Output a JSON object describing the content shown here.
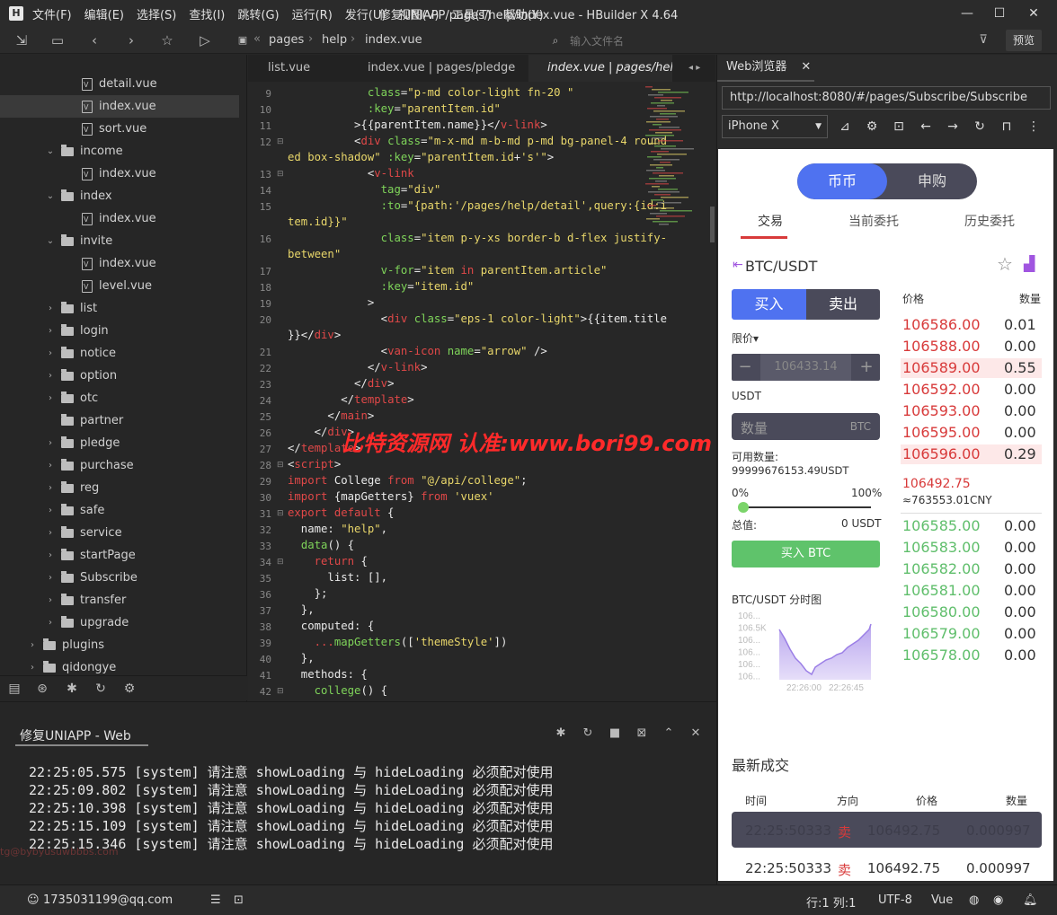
{
  "titlebar": {
    "app_icon": "H",
    "menu": [
      "文件(F)",
      "编辑(E)",
      "选择(S)",
      "查找(I)",
      "跳转(G)",
      "运行(R)",
      "发行(U)",
      "视图(V)",
      "工具(T)",
      "帮助(Y)"
    ],
    "title": "修复UNIAPP/pages/help/index.vue - HBuilder X 4.64"
  },
  "toolbar": {
    "breadcrumb": [
      "pages",
      "help",
      "index.vue"
    ],
    "file_search_placeholder": "输入文件名",
    "preview": "预览"
  },
  "sidebar": {
    "items": [
      {
        "label": "detail.vue",
        "type": "file",
        "depth": 3
      },
      {
        "label": "index.vue",
        "type": "file",
        "depth": 3,
        "selected": true
      },
      {
        "label": "sort.vue",
        "type": "file",
        "depth": 3
      },
      {
        "label": "income",
        "type": "folder",
        "depth": 2,
        "open": true
      },
      {
        "label": "index.vue",
        "type": "file",
        "depth": 3
      },
      {
        "label": "index",
        "type": "folder",
        "depth": 2,
        "open": true
      },
      {
        "label": "index.vue",
        "type": "file",
        "depth": 3
      },
      {
        "label": "invite",
        "type": "folder",
        "depth": 2,
        "open": true
      },
      {
        "label": "index.vue",
        "type": "file",
        "depth": 3
      },
      {
        "label": "level.vue",
        "type": "file",
        "depth": 3
      },
      {
        "label": "list",
        "type": "folder",
        "depth": 2
      },
      {
        "label": "login",
        "type": "folder",
        "depth": 2
      },
      {
        "label": "notice",
        "type": "folder",
        "depth": 2
      },
      {
        "label": "option",
        "type": "folder",
        "depth": 2
      },
      {
        "label": "otc",
        "type": "folder",
        "depth": 2
      },
      {
        "label": "partner",
        "type": "folder",
        "depth": 2,
        "empty": true
      },
      {
        "label": "pledge",
        "type": "folder",
        "depth": 2
      },
      {
        "label": "purchase",
        "type": "folder",
        "depth": 2
      },
      {
        "label": "reg",
        "type": "folder",
        "depth": 2
      },
      {
        "label": "safe",
        "type": "folder",
        "depth": 2
      },
      {
        "label": "service",
        "type": "folder",
        "depth": 2
      },
      {
        "label": "startPage",
        "type": "folder",
        "depth": 2
      },
      {
        "label": "Subscribe",
        "type": "folder",
        "depth": 2
      },
      {
        "label": "transfer",
        "type": "folder",
        "depth": 2
      },
      {
        "label": "upgrade",
        "type": "folder",
        "depth": 2
      },
      {
        "label": "plugins",
        "type": "folder",
        "depth": 1
      },
      {
        "label": "qidongye",
        "type": "folder",
        "depth": 1
      }
    ]
  },
  "editor": {
    "tabs": [
      "list.vue",
      "index.vue | pages/pledge",
      "index.vue | pages/help"
    ],
    "lines": [
      {
        "n": "9",
        "html": "            <span class='a'>class</span>=<span class='s'>\"p-md color-light fn-20 \"</span>"
      },
      {
        "n": "10",
        "html": "            <span class='a'>:key</span>=<span class='s'>\"parentItem.id\"</span>"
      },
      {
        "n": "11",
        "html": "          >{{parentItem.name}}&lt;/<span class='k'>v-link</span>>"
      },
      {
        "n": "12",
        "fold": true,
        "html": "          &lt;<span class='k'>div</span> <span class='a'>class</span>=<span class='s'>\"m-x-md m-b-md p-md bg-panel-4 round</span>"
      },
      {
        "n": "",
        "html": "<span class='s'>ed box-shadow\"</span> <span class='a'>:key</span>=<span class='s'>\"parentItem.id</span>+<span class='s'>'s'\"</span>>"
      },
      {
        "n": "13",
        "fold": true,
        "html": "            &lt;<span class='k'>v-link</span>"
      },
      {
        "n": "14",
        "html": "              <span class='a'>tag</span>=<span class='s'>\"div\"</span>"
      },
      {
        "n": "15",
        "html": "              <span class='a'>:to</span>=<span class='s'>\"{path:'/pages/help/detail',query:{id:i</span>"
      },
      {
        "n": "",
        "html": "<span class='s'>tem.id}}\"</span>"
      },
      {
        "n": "16",
        "html": "              <span class='a'>class</span>=<span class='s'>\"item p-y-xs border-b d-flex justify-</span>"
      },
      {
        "n": "",
        "html": "<span class='s'>between\"</span>"
      },
      {
        "n": "17",
        "html": "              <span class='a'>v-for</span>=<span class='s'>\"item </span><span class='k'>in</span><span class='s'> parentItem.article\"</span>"
      },
      {
        "n": "18",
        "html": "              <span class='a'>:key</span>=<span class='s'>\"item.id\"</span>"
      },
      {
        "n": "19",
        "html": "            >"
      },
      {
        "n": "20",
        "html": "              &lt;<span class='k'>div</span> <span class='a'>class</span>=<span class='s'>\"eps-1 color-light\"</span>>{{item.title"
      },
      {
        "n": "",
        "html": "}}&lt;/<span class='k'>div</span>>"
      },
      {
        "n": "21",
        "html": "              &lt;<span class='k'>van-icon</span> <span class='a'>name</span>=<span class='s'>\"arrow\"</span> />"
      },
      {
        "n": "22",
        "html": "            &lt;/<span class='k'>v-link</span>>"
      },
      {
        "n": "23",
        "html": "          &lt;/<span class='k'>div</span>>"
      },
      {
        "n": "24",
        "html": "        &lt;/<span class='k'>template</span>>"
      },
      {
        "n": "25",
        "html": "      &lt;/<span class='k'>main</span>>"
      },
      {
        "n": "26",
        "html": "    &lt;/<span class='k'>div</span>>"
      },
      {
        "n": "27",
        "html": "&lt;/<span class='k'>template</span>>"
      },
      {
        "n": "28",
        "fold": true,
        "html": "&lt;<span class='k'>script</span>>"
      },
      {
        "n": "29",
        "html": "<span class='k'>import</span> College <span class='k'>from</span> <span class='s'>\"@/api/college\"</span>;"
      },
      {
        "n": "30",
        "html": "<span class='k'>import</span> {mapGetters} <span class='k'>from</span> <span class='s'>'vuex'</span>"
      },
      {
        "n": "31",
        "fold": true,
        "html": "<span class='k'>export default</span> {"
      },
      {
        "n": "32",
        "html": "  name: <span class='s'>\"help\"</span>,"
      },
      {
        "n": "33",
        "html": "  <span class='a'>data</span>() {"
      },
      {
        "n": "34",
        "fold": true,
        "html": "    <span class='k'>return</span> {"
      },
      {
        "n": "35",
        "html": "      list: [],"
      },
      {
        "n": "36",
        "html": "    };"
      },
      {
        "n": "37",
        "html": "  },"
      },
      {
        "n": "38",
        "html": "  computed: {"
      },
      {
        "n": "39",
        "html": "    <span class='k'>...</span><span class='a'>mapGetters</span>([<span class='s'>'themeStyle'</span>])"
      },
      {
        "n": "40",
        "html": "  },"
      },
      {
        "n": "41",
        "html": "  methods: {"
      },
      {
        "n": "42",
        "fold": true,
        "html": "    <span class='a'>college</span>() {"
      }
    ]
  },
  "watermark": "比特资源网 认准:www.bori99.com",
  "console": {
    "title": "修复UNIAPP - Web",
    "logs": [
      "22:25:05.575 [system] 请注意 showLoading 与 hideLoading 必须配对使用",
      "22:25:09.802 [system] 请注意 showLoading 与 hideLoading 必须配对使用",
      "22:25:10.398 [system] 请注意 showLoading 与 hideLoading 必须配对使用",
      "22:25:15.109 [system] 请注意 showLoading 与 hideLoading 必须配对使用",
      "22:25:15.346 [system] 请注意 showLoading 与 hideLoading 必须配对使用"
    ],
    "faint_text": "tg@bybyusuwbbbs.com"
  },
  "statusbar": {
    "account": "1735031199@qq.com",
    "position": "行:1  列:1",
    "encoding": "UTF-8",
    "language": "Vue"
  },
  "browser": {
    "tab": "Web浏览器",
    "url": "http://localhost:8080/#/pages/Subscribe/Subscribe",
    "device": "iPhone X"
  },
  "app": {
    "seg": [
      "币币",
      "申购"
    ],
    "tabs": [
      "交易",
      "当前委托",
      "历史委托"
    ],
    "pair": "BTC/USDT",
    "buy": "买入",
    "sell": "卖出",
    "order_type": "限价▾",
    "price": "106433.14",
    "unit": "USDT",
    "qty_placeholder": "数量",
    "qty_unit": "BTC",
    "available_label": "可用数量:",
    "available_value": "99999676153.49USDT",
    "pct_min": "0%",
    "pct_max": "100%",
    "total_label": "总值:",
    "total_value": "0 USDT",
    "buy_btn": "买入 BTC",
    "ob_price": "价格",
    "ob_qty": "数量",
    "asks": [
      {
        "p": "106586.00",
        "q": "0.01"
      },
      {
        "p": "106588.00",
        "q": "0.00"
      },
      {
        "p": "106589.00",
        "q": "0.55",
        "hl": true
      },
      {
        "p": "106592.00",
        "q": "0.00"
      },
      {
        "p": "106593.00",
        "q": "0.00"
      },
      {
        "p": "106595.00",
        "q": "0.00"
      },
      {
        "p": "106596.00",
        "q": "0.29",
        "hl": true
      }
    ],
    "last_price": "106492.75",
    "cny": "≈763553.01CNY",
    "bids": [
      {
        "p": "106585.00",
        "q": "0.00"
      },
      {
        "p": "106583.00",
        "q": "0.00"
      },
      {
        "p": "106582.00",
        "q": "0.00"
      },
      {
        "p": "106581.00",
        "q": "0.00"
      },
      {
        "p": "106580.00",
        "q": "0.00"
      },
      {
        "p": "106579.00",
        "q": "0.00"
      },
      {
        "p": "106578.00",
        "q": "0.00"
      }
    ],
    "chart_title": "BTC/USDT 分时图",
    "chart_yticks": [
      "106...",
      "106.5K",
      "106...",
      "106...",
      "106...",
      "106..."
    ],
    "chart_xticks": [
      "22:26:00",
      "22:26:45"
    ],
    "latest_title": "最新成交",
    "trade_head": [
      "时间",
      "方向",
      "价格",
      "数量"
    ],
    "trades": [
      {
        "time": "22:25:50333",
        "dir": "卖",
        "price": "106492.75",
        "qty": "0.000997",
        "dark": true
      },
      {
        "time": "22:25:50333",
        "dir": "卖",
        "price": "106492.75",
        "qty": "0.000997"
      }
    ]
  },
  "colors": {
    "accent": "#4f72f0",
    "ask": "#d83a3a",
    "bid": "#5fbe6b",
    "panel": "#4a4a5a"
  }
}
